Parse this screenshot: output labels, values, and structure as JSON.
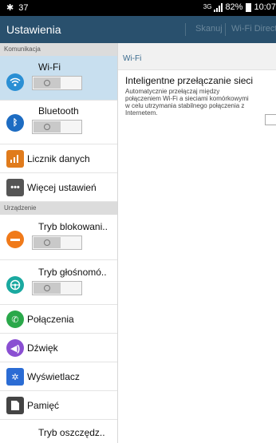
{
  "statusbar": {
    "left_icon_label": "37",
    "network": "3G",
    "battery": "82%",
    "time": "10:07"
  },
  "actionbar": {
    "title": "Ustawienia",
    "action_scan": "Skanuj",
    "action_direct": "Wi-Fi Direct"
  },
  "sidebar": {
    "section_connections": "Komunikacja",
    "section_device": "Urządzenie",
    "items": [
      {
        "label": "Wi-Fi"
      },
      {
        "label": "Bluetooth"
      },
      {
        "label": "Licznik danych"
      },
      {
        "label": "Więcej ustawień"
      },
      {
        "label": "Tryb blokowani.."
      },
      {
        "label": "Tryb głośnomó.."
      },
      {
        "label": "Połączenia"
      },
      {
        "label": "Dźwięk"
      },
      {
        "label": "Wyświetlacz"
      },
      {
        "label": "Pamięć"
      },
      {
        "label": "Tryb oszczędz.."
      }
    ]
  },
  "detail": {
    "header": "Wi-Fi",
    "title": "Inteligentne przełączanie sieci",
    "description": "Automatycznie przełączaj między połączeniem Wi-Fi a sieciami komórkowymi w celu utrzymania stabilnego połączenia z Internetem."
  },
  "colors": {
    "actionbar": "#29506d",
    "selected": "#c8dfef",
    "wifi_icon": "#2a8fd4",
    "bluetooth_icon": "#1d6cc2",
    "data_icon": "#e07b1c",
    "more_icon": "#555555",
    "block_icon": "#f07a1a",
    "drive_icon": "#1aa9a0",
    "call_icon": "#2aa84a",
    "sound_icon": "#8a4fd2",
    "display_icon": "#2b6cd4",
    "storage_icon": "#444444"
  }
}
